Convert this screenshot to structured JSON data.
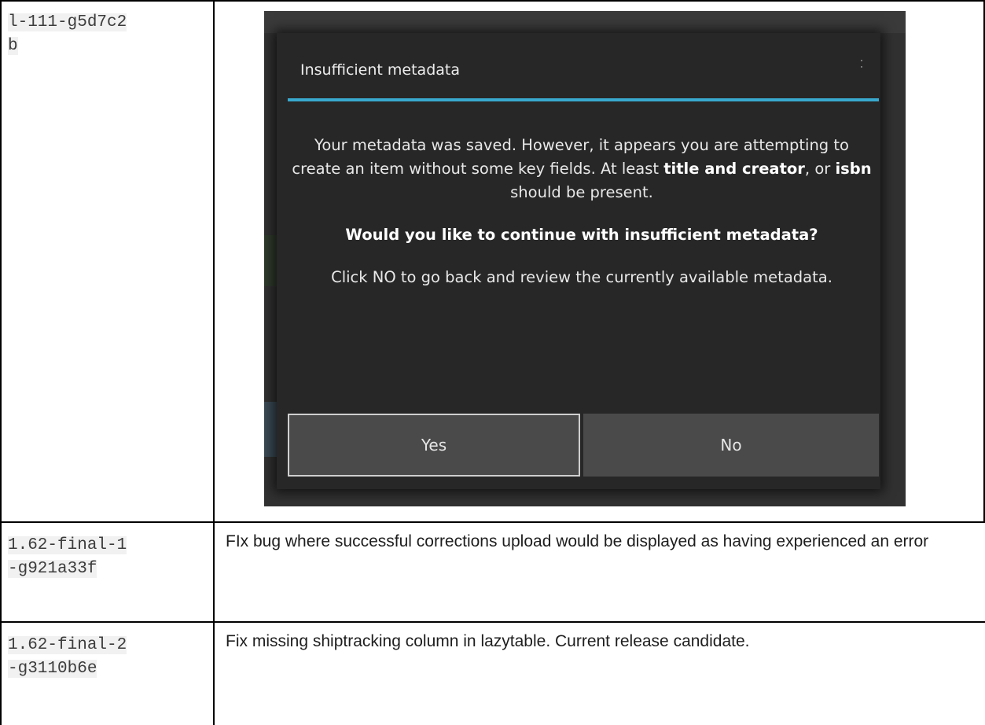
{
  "rows": [
    {
      "version": "l-111-g5d7c2b",
      "version_lines": [
        "l-111-g5d7c2",
        "b"
      ]
    },
    {
      "version": "1.62-final-1-g921a33f",
      "version_lines": [
        "1.62-final-1",
        "-g921a33f"
      ],
      "description": "FIx bug where successful corrections upload would be displayed as having experienced an error"
    },
    {
      "version": "1.62-final-2-g3110b6e",
      "version_lines": [
        "1.62-final-2",
        "-g3110b6e"
      ],
      "description": "Fix missing shiptracking column in lazytable. Current release candidate."
    }
  ],
  "dialog": {
    "title": "Insufficient metadata",
    "message_plain_1": "Your metadata was saved. However, it appears you are attempting to create an item without some key fields. At least ",
    "message_bold_1": "title and creator",
    "message_plain_2": ", or ",
    "message_bold_2": "isbn",
    "message_plain_3": " should be present.",
    "question": "Would you like to continue with insufficient metadata?",
    "hint": "Click NO to go back and review the currently available metadata.",
    "yes_label": "Yes",
    "no_label": "No"
  },
  "colors": {
    "dialog_background": "#272727",
    "title_rule": "#39a9cf",
    "button_background": "#4a4a4a"
  }
}
